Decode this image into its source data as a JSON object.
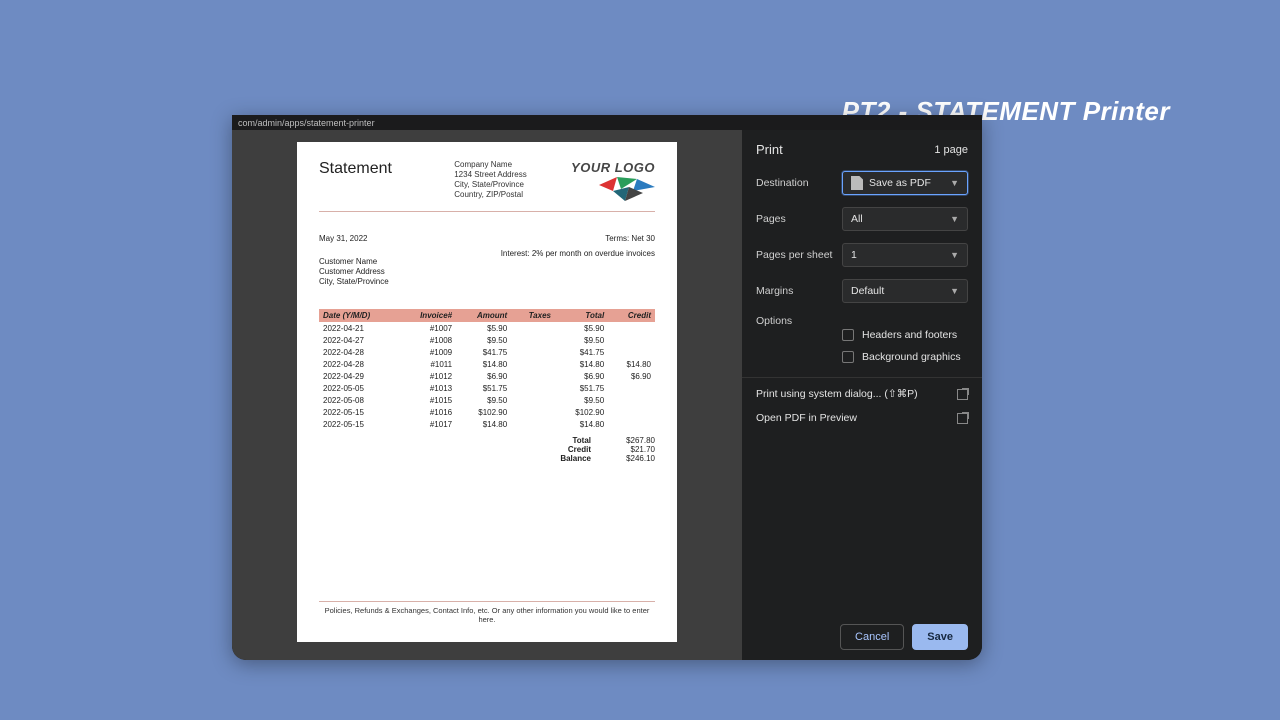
{
  "banner": "PT2 - STATEMENT  Printer",
  "url_tail": "com/admin/apps/statement-printer",
  "statement": {
    "title": "Statement",
    "company": {
      "name": "Company Name",
      "street": "1234 Street Address",
      "citystate": "City, State/Province",
      "country": "Country, ZIP/Postal"
    },
    "logo_text": "YOUR LOGO",
    "date": "May 31, 2022",
    "terms": "Terms: Net 30",
    "interest": "Interest: 2% per month on overdue invoices",
    "customer": {
      "name": "Customer Name",
      "addr": "Customer Address",
      "citystate": "City, State/Province"
    },
    "columns": [
      "Date (Y/M/D)",
      "Invoice#",
      "Amount",
      "Taxes",
      "Total",
      "Credit"
    ],
    "rows": [
      {
        "d": "2022-04-21",
        "inv": "#1007",
        "amt": "$5.90",
        "tax": "",
        "tot": "$5.90",
        "cr": ""
      },
      {
        "d": "2022-04-27",
        "inv": "#1008",
        "amt": "$9.50",
        "tax": "",
        "tot": "$9.50",
        "cr": ""
      },
      {
        "d": "2022-04-28",
        "inv": "#1009",
        "amt": "$41.75",
        "tax": "",
        "tot": "$41.75",
        "cr": ""
      },
      {
        "d": "2022-04-28",
        "inv": "#1011",
        "amt": "$14.80",
        "tax": "",
        "tot": "$14.80",
        "cr": "$14.80"
      },
      {
        "d": "2022-04-29",
        "inv": "#1012",
        "amt": "$6.90",
        "tax": "",
        "tot": "$6.90",
        "cr": "$6.90"
      },
      {
        "d": "2022-05-05",
        "inv": "#1013",
        "amt": "$51.75",
        "tax": "",
        "tot": "$51.75",
        "cr": ""
      },
      {
        "d": "2022-05-08",
        "inv": "#1015",
        "amt": "$9.50",
        "tax": "",
        "tot": "$9.50",
        "cr": ""
      },
      {
        "d": "2022-05-15",
        "inv": "#1016",
        "amt": "$102.90",
        "tax": "",
        "tot": "$102.90",
        "cr": ""
      },
      {
        "d": "2022-05-15",
        "inv": "#1017",
        "amt": "$14.80",
        "tax": "",
        "tot": "$14.80",
        "cr": ""
      }
    ],
    "totals": {
      "total_lab": "Total",
      "total_val": "$267.80",
      "credit_lab": "Credit",
      "credit_val": "$21.70",
      "balance_lab": "Balance",
      "balance_val": "$246.10"
    },
    "footer": "Policies, Refunds & Exchanges, Contact Info, etc.  Or any other information you would like to enter here."
  },
  "panel": {
    "title": "Print",
    "count": "1 page",
    "destination_lab": "Destination",
    "destination_val": "Save as PDF",
    "pages_lab": "Pages",
    "pages_val": "All",
    "pps_lab": "Pages per sheet",
    "pps_val": "1",
    "margins_lab": "Margins",
    "margins_val": "Default",
    "options_lab": "Options",
    "opt_headers": "Headers and footers",
    "opt_bg": "Background graphics",
    "sys_dialog": "Print using system dialog... (⇧⌘P)",
    "open_pdf": "Open PDF in Preview",
    "cancel": "Cancel",
    "save": "Save"
  }
}
